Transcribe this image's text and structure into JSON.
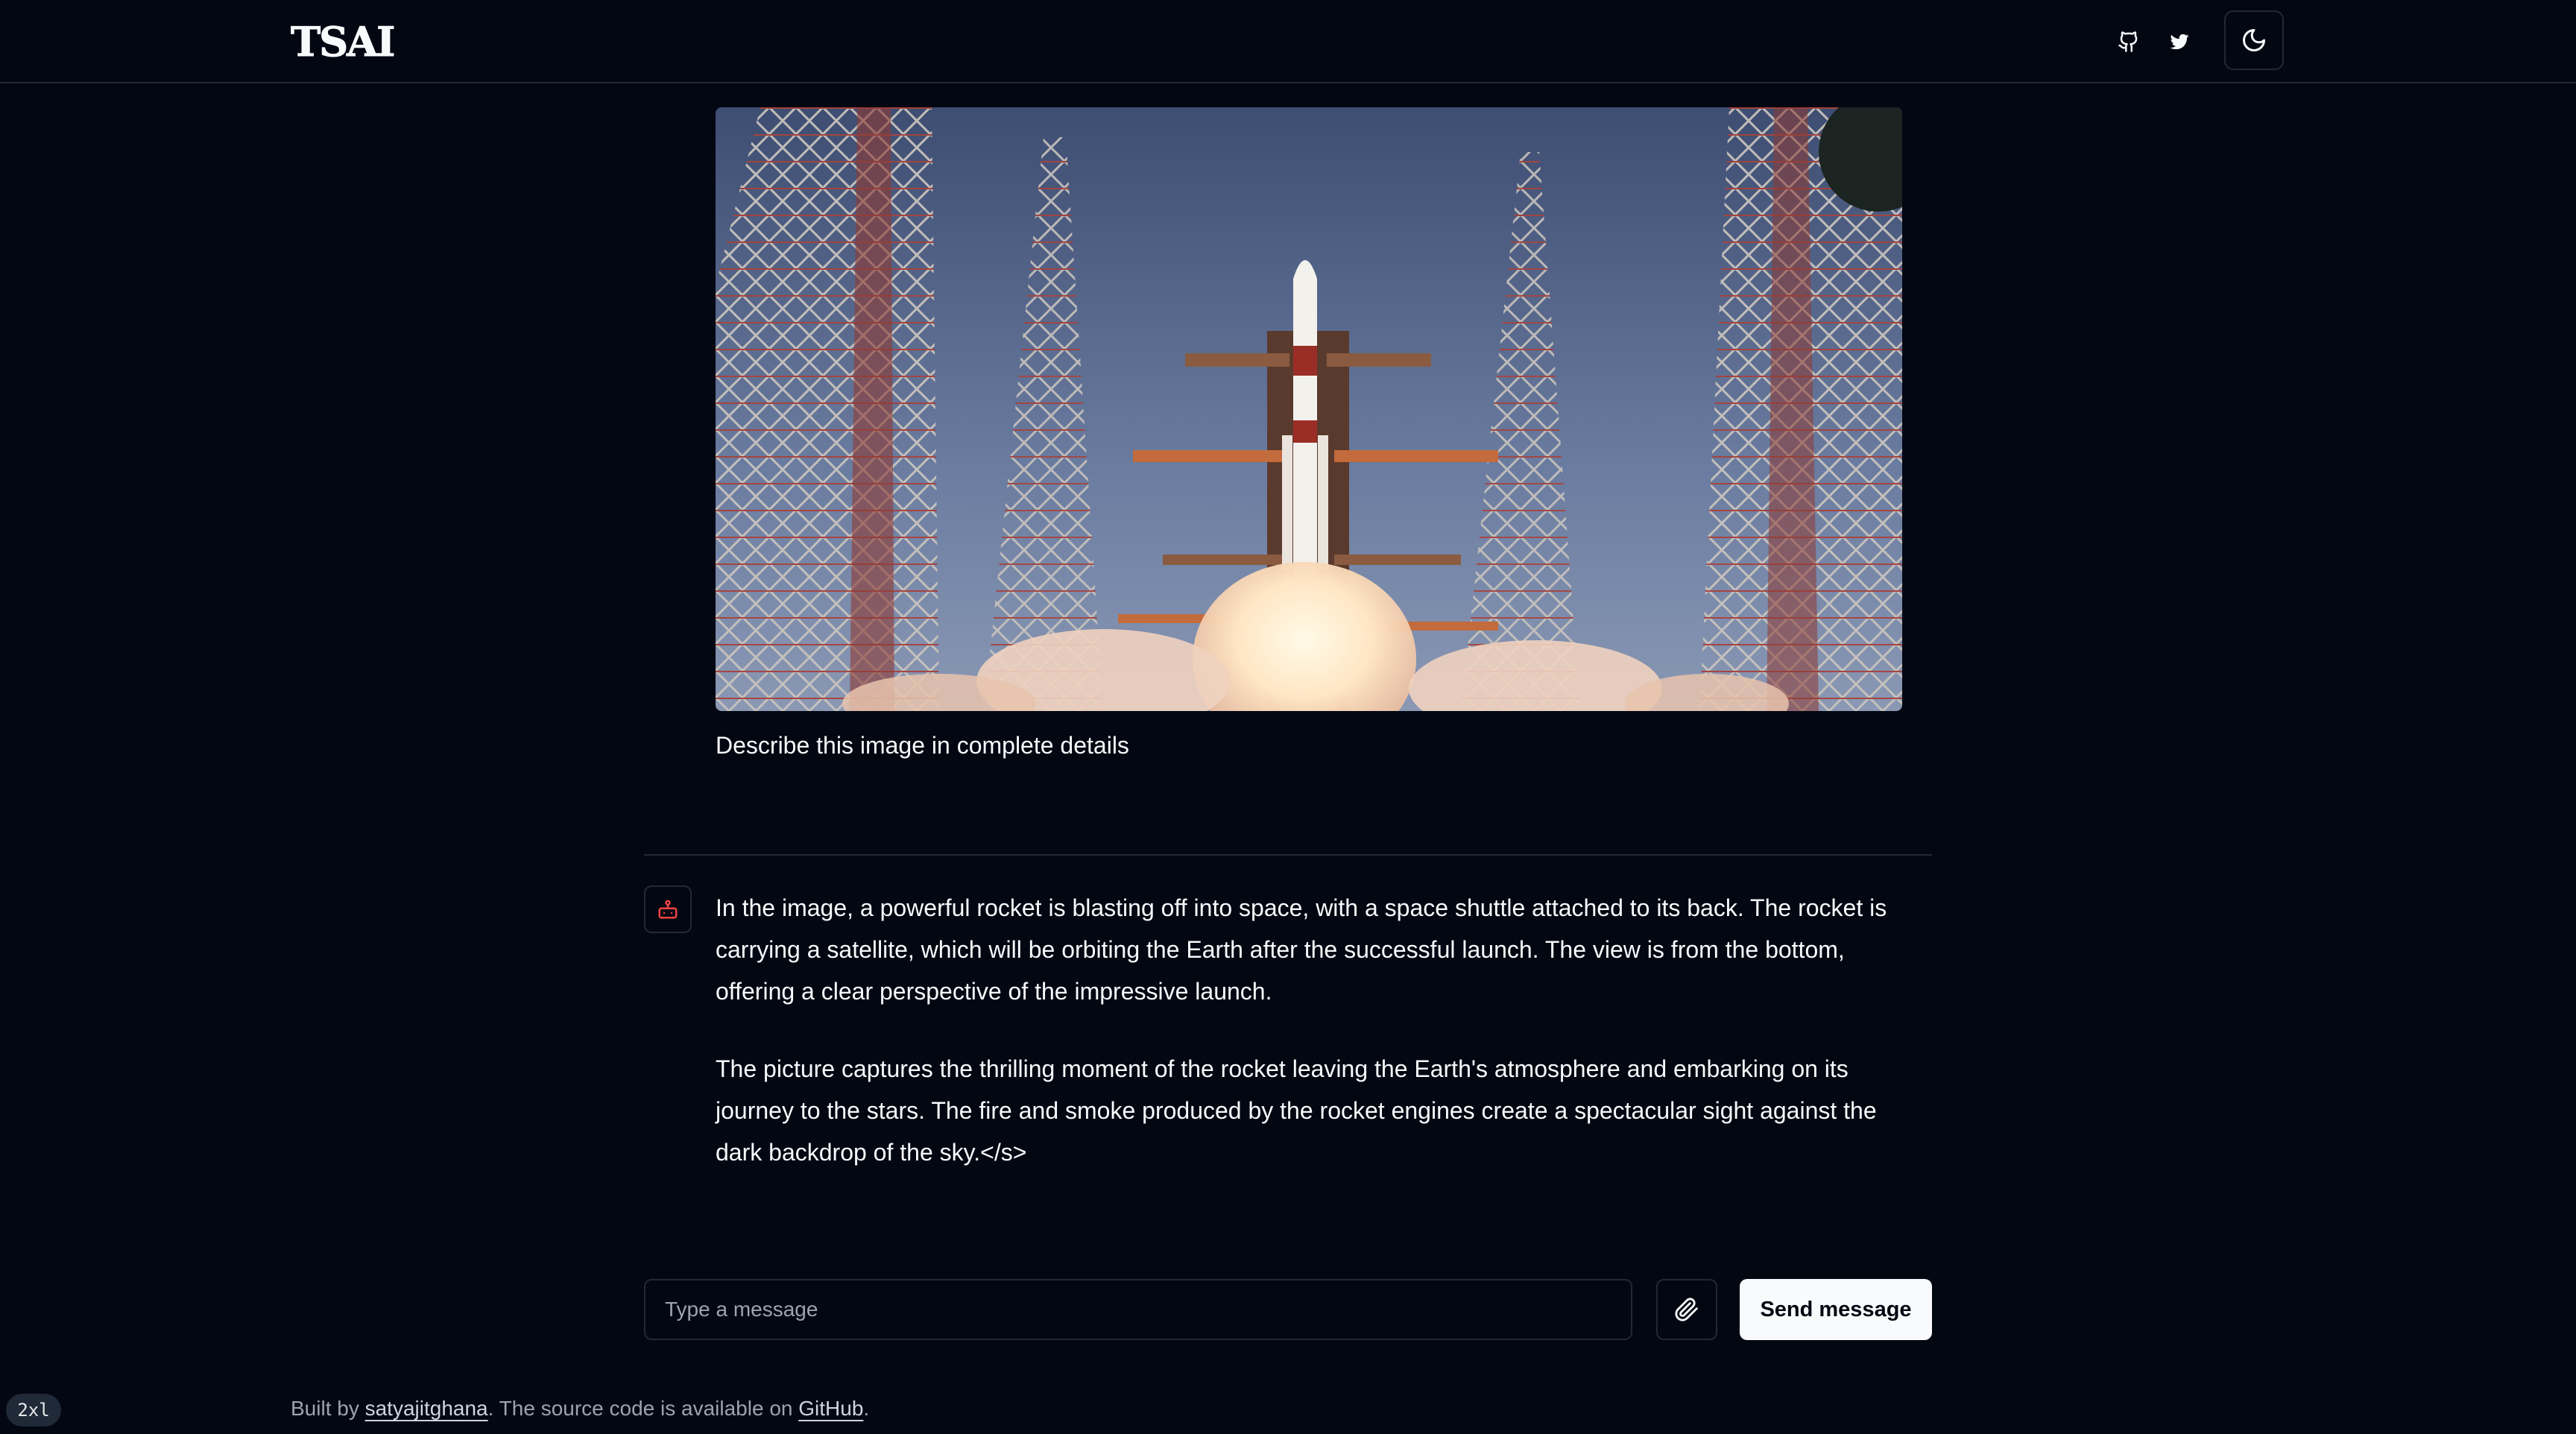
{
  "header": {
    "logo": "TSAI",
    "github_icon": "github-icon",
    "twitter_icon": "twitter-icon",
    "theme_icon": "moon-icon"
  },
  "chat": {
    "image_alt": "Rocket launching from a launch pad between steel lattice towers",
    "user_message": "Describe this image in complete details",
    "bot_avatar_icon": "bot-icon",
    "bot_paragraphs": [
      "In the image, a powerful rocket is blasting off into space, with a space shuttle attached to its back. The rocket is carrying a satellite, which will be orbiting the Earth after the successful launch. The view is from the bottom, offering a clear perspective of the impressive launch.",
      "The picture captures the thrilling moment of the rocket leaving the Earth's atmosphere and embarking on its journey to the stars. The fire and smoke produced by the rocket engines create a spectacular sight against the dark backdrop of the sky.</s>"
    ]
  },
  "composer": {
    "placeholder": "Type a message",
    "attach_icon": "paperclip-icon",
    "send_label": "Send message"
  },
  "footer": {
    "built_by": "Built by ",
    "author": "satyajitghana",
    "middle": ". The source code is available on ",
    "source_link": "GitHub",
    "end": "."
  },
  "breakpoint_badge": "2xl",
  "colors": {
    "background": "#030712",
    "border": "#1f2937",
    "text": "#f8fafc",
    "muted": "#9ca3af",
    "bot_icon": "#ef4444"
  }
}
